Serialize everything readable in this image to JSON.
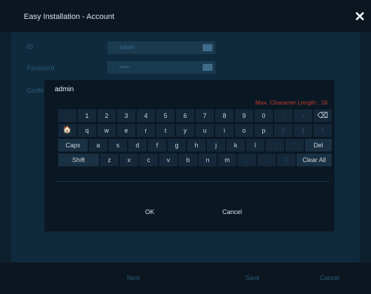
{
  "window": {
    "title": "Easy Installation - Account",
    "close_label": "✕"
  },
  "form": {
    "id_label": "ID",
    "id_value": "admin",
    "password_label": "Password",
    "password_value": "•••••",
    "confirm_label": "Confirm Pa"
  },
  "keyboard": {
    "input_value": "admin",
    "max_length_text": "Max. Character Length : 16",
    "row1": [
      "`",
      "1",
      "2",
      "3",
      "4",
      "5",
      "6",
      "7",
      "8",
      "9",
      "0",
      "-",
      "=",
      "⌫"
    ],
    "row2": [
      "🏠",
      "q",
      "w",
      "e",
      "r",
      "t",
      "y",
      "u",
      "i",
      "o",
      "p",
      "[",
      "]",
      "\\"
    ],
    "row3": [
      "Caps",
      "a",
      "s",
      "d",
      "f",
      "g",
      "h",
      "j",
      "k",
      "l",
      ";",
      "'",
      "Del"
    ],
    "row4": [
      "Shift",
      "z",
      "x",
      "c",
      "v",
      "b",
      "n",
      "m",
      ",",
      ".",
      "/",
      "Clear All"
    ],
    "ok_label": "OK",
    "cancel_label": "Cancel"
  },
  "footer": {
    "next_label": "Next",
    "save_label": "Save",
    "cancel_label": "Cancel"
  }
}
